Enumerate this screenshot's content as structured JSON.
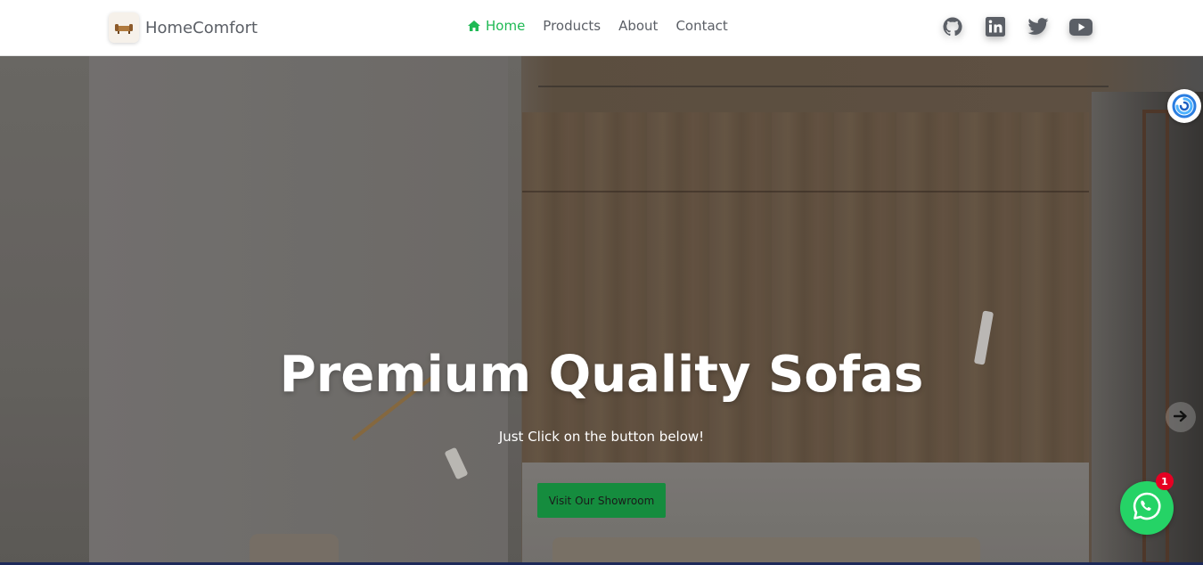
{
  "brand": {
    "name": "HomeComfort"
  },
  "nav": {
    "items": [
      {
        "label": "Home",
        "active": true
      },
      {
        "label": "Products",
        "active": false
      },
      {
        "label": "About",
        "active": false
      },
      {
        "label": "Contact",
        "active": false
      }
    ]
  },
  "socials": [
    "github-icon",
    "linkedin-icon",
    "twitter-icon",
    "youtube-icon"
  ],
  "hero": {
    "title": "Premium Quality Sofas",
    "subtitle": "Just Click on the button below!",
    "button_label": "Visit Our Showroom"
  },
  "whatsapp": {
    "badge_count": "1"
  },
  "colors": {
    "accent_green": "#1fb954",
    "button_green": "#158c3e",
    "whatsapp_green": "#25d366",
    "badge_red": "#e60023",
    "nav_text": "#5b5f66"
  }
}
